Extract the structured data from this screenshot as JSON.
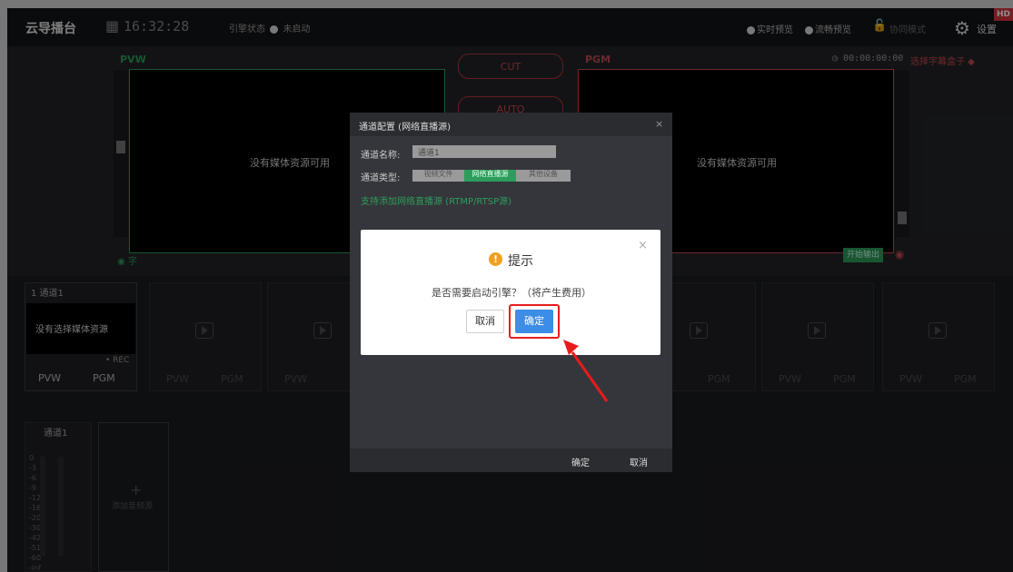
{
  "topbar": {
    "brand": "云导播台",
    "clock": "16:32:28",
    "engine_label": "引擎状态",
    "engine_state": "未启动",
    "realtime_preview": "实时预览",
    "smooth_preview": "流畅预览",
    "collab_mode": "协同模式",
    "settings": "设置",
    "hd_badge": "HD"
  },
  "pvw": {
    "label": "PVW",
    "empty": "没有媒体资源可用",
    "subtitle_label": "字"
  },
  "center": {
    "cut": "CUT",
    "auto": "AUTO"
  },
  "pgm": {
    "label": "PGM",
    "timer": "00:00:00:00",
    "caption_box": "选择字幕盒子",
    "empty": "没有媒体资源可用",
    "start_output": "开始输出"
  },
  "channel1": {
    "title": "1 通道1",
    "empty": "没有选择媒体资源",
    "rec": "• REC",
    "pvw": "PVW",
    "pgm": "PGM"
  },
  "channel_buttons": {
    "pvw": "PVW",
    "pgm": "PGM"
  },
  "audio": {
    "channel": "通道1",
    "scale": [
      "0",
      "-3",
      "-6",
      "-9",
      "-12",
      "-16",
      "-20",
      "-30",
      "-42",
      "-51",
      "-60",
      "-inf"
    ],
    "add_label": "添加音频源"
  },
  "config_dialog": {
    "title": "通道配置 (网络直播源)",
    "name_label": "通道名称:",
    "name_value": "通道1",
    "type_label": "通道类型:",
    "type_options": [
      "视频文件",
      "网络直播源",
      "其他设备"
    ],
    "selected_type": "网络直播源",
    "hint": "支持添加网络直播源 (RTMP/RTSP源)",
    "ok": "确定",
    "cancel": "取消"
  },
  "prompt_dialog": {
    "title": "提示",
    "message": "是否需要启动引擎？（将产生费用）",
    "cancel": "取消",
    "ok": "确定",
    "close": "×"
  },
  "colors": {
    "accent_red": "#e81b1b",
    "primary_blue": "#3c8de6",
    "green": "#2d9d5c",
    "warning": "#f0a020"
  }
}
